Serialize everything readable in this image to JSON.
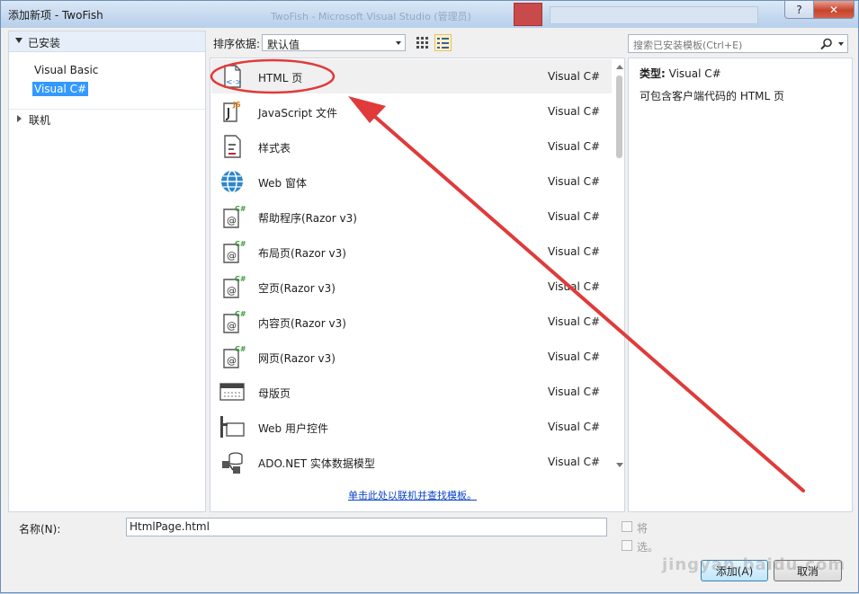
{
  "window": {
    "title": "添加新项 - TwoFish",
    "help_glyph": "?",
    "close_glyph": "✕",
    "ghost_title": "TwoFish - Microsoft Visual Studio (管理员)"
  },
  "left_pane": {
    "installed_label": "已安装",
    "tree_items": [
      "Visual Basic",
      "Visual C#"
    ],
    "selected_index": 1,
    "online_label": "联机"
  },
  "toolbar": {
    "sort_label": "排序依据:",
    "sort_value": "默认值"
  },
  "search": {
    "placeholder": "搜索已安装模板(Ctrl+E)"
  },
  "templates": [
    {
      "name": "HTML 页",
      "lang": "Visual C#",
      "icon": "html-page-icon"
    },
    {
      "name": "JavaScript 文件",
      "lang": "Visual C#",
      "icon": "javascript-file-icon"
    },
    {
      "name": "样式表",
      "lang": "Visual C#",
      "icon": "stylesheet-icon"
    },
    {
      "name": "Web 窗体",
      "lang": "Visual C#",
      "icon": "web-form-globe-icon"
    },
    {
      "name": "帮助程序(Razor v3)",
      "lang": "Visual C#",
      "icon": "razor-page-icon"
    },
    {
      "name": "布局页(Razor v3)",
      "lang": "Visual C#",
      "icon": "razor-page-icon"
    },
    {
      "name": "空页(Razor v3)",
      "lang": "Visual C#",
      "icon": "razor-page-icon"
    },
    {
      "name": "内容页(Razor v3)",
      "lang": "Visual C#",
      "icon": "razor-page-icon"
    },
    {
      "name": "网页(Razor v3)",
      "lang": "Visual C#",
      "icon": "razor-page-icon"
    },
    {
      "name": "母版页",
      "lang": "Visual C#",
      "icon": "master-page-icon"
    },
    {
      "name": "Web 用户控件",
      "lang": "Visual C#",
      "icon": "user-control-icon"
    },
    {
      "name": "ADO.NET 实体数据模型",
      "lang": "Visual C#",
      "icon": "entity-model-icon"
    }
  ],
  "selected_template": 0,
  "online_link": "单击此处以联机并查找模板。",
  "details": {
    "type_label": "类型:",
    "type_value": "Visual C#",
    "description": "可包含客户端代码的 HTML 页"
  },
  "bottom": {
    "name_label": "名称(N):",
    "name_value": "HtmlPage.html",
    "option1": "将",
    "option2": "选。",
    "add_button": "添加(A)",
    "cancel_button": "取消"
  },
  "watermark": "jingyan.baidu.com",
  "colors": {
    "selection": "#3399ff",
    "annotation_red": "#e03a3a",
    "link": "#0a43c8"
  }
}
